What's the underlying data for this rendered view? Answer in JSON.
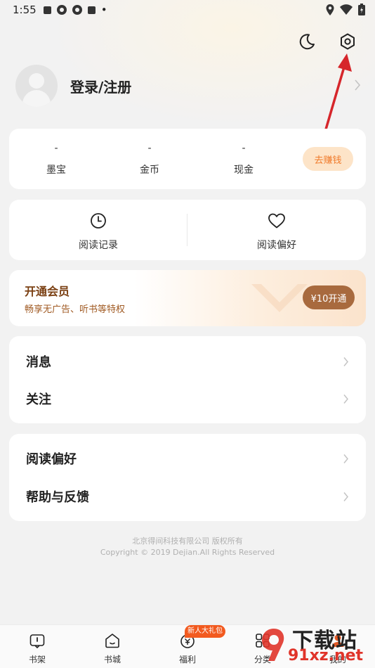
{
  "status_bar": {
    "time": "1:55",
    "dot": "•"
  },
  "profile": {
    "name": "登录/注册"
  },
  "wallet": {
    "items": [
      {
        "value": "-",
        "label": "墨宝"
      },
      {
        "value": "-",
        "label": "金币"
      },
      {
        "value": "-",
        "label": "现金"
      }
    ],
    "earn_label": "去赚钱"
  },
  "quick": {
    "items": [
      {
        "label": "阅读记录",
        "icon": "clock-icon"
      },
      {
        "label": "阅读偏好",
        "icon": "heart-icon"
      }
    ]
  },
  "vip": {
    "title": "开通会员",
    "subtitle": "畅享无广告、听书等特权",
    "button": "¥10开通"
  },
  "menu1": {
    "items": [
      {
        "label": "消息"
      },
      {
        "label": "关注"
      }
    ]
  },
  "menu2": {
    "items": [
      {
        "label": "阅读偏好"
      },
      {
        "label": "帮助与反馈"
      }
    ]
  },
  "footer": {
    "line1": "北京得间科技有限公司 版权所有",
    "line2": "Copyright © 2019 Dejian.All Rights Reserved"
  },
  "tabbar": {
    "badge": "新人大礼包",
    "items": [
      {
        "label": "书架",
        "icon": "bookshelf-icon"
      },
      {
        "label": "书城",
        "icon": "bookstore-icon"
      },
      {
        "label": "福利",
        "icon": "welfare-icon"
      },
      {
        "label": "分类",
        "icon": "category-icon"
      },
      {
        "label": "我的",
        "icon": "profile-icon"
      }
    ]
  },
  "watermark": {
    "line1": "下载站",
    "line2": "91xz.net"
  },
  "colors": {
    "accent": "#f07a2a",
    "vip_button": "#a86a3e",
    "annotation_arrow": "#d6262b",
    "badge": "#f25a1f"
  }
}
